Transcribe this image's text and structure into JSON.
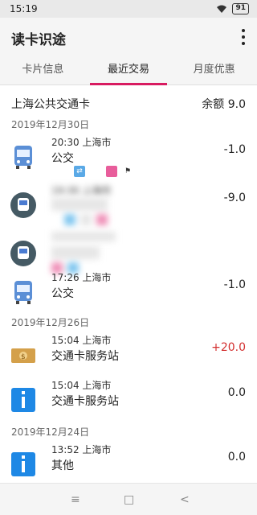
{
  "status": {
    "time": "15:19",
    "battery": "91"
  },
  "app": {
    "title": "读卡识途"
  },
  "tabs": [
    {
      "label": "卡片信息"
    },
    {
      "label": "最近交易"
    },
    {
      "label": "月度优惠"
    }
  ],
  "card": {
    "name": "上海公共交通卡",
    "balance": "余额 9.0"
  },
  "dates": [
    "2019年12月30日",
    "2019年12月26日",
    "2019年12月24日"
  ],
  "transactions": [
    {
      "meta": "20:30  上海市",
      "label": "公交",
      "amount": "-1.0",
      "icon": "bus-icon"
    },
    {
      "meta": "19:30  上海市",
      "label": "",
      "amount": "-9.0",
      "icon": "metro-icon"
    },
    {
      "meta": "",
      "label": "",
      "amount": "",
      "icon": "metro-icon"
    },
    {
      "meta": "17:26  上海市",
      "label": "公交",
      "amount": "-1.0",
      "icon": "bus-icon"
    },
    {
      "meta": "15:04  上海市",
      "label": "交通卡服务站",
      "amount": "+20.0",
      "icon": "money-icon"
    },
    {
      "meta": "15:04  上海市",
      "label": "交通卡服务站",
      "amount": "0.0",
      "icon": "info-icon"
    },
    {
      "meta": "13:52  上海市",
      "label": "其他",
      "amount": "0.0",
      "icon": "info-icon"
    }
  ],
  "colors": {
    "accent": "#d81b60",
    "positive": "#d32f2f"
  },
  "nav": {
    "menu": "≡",
    "home": "□",
    "back": "<"
  }
}
